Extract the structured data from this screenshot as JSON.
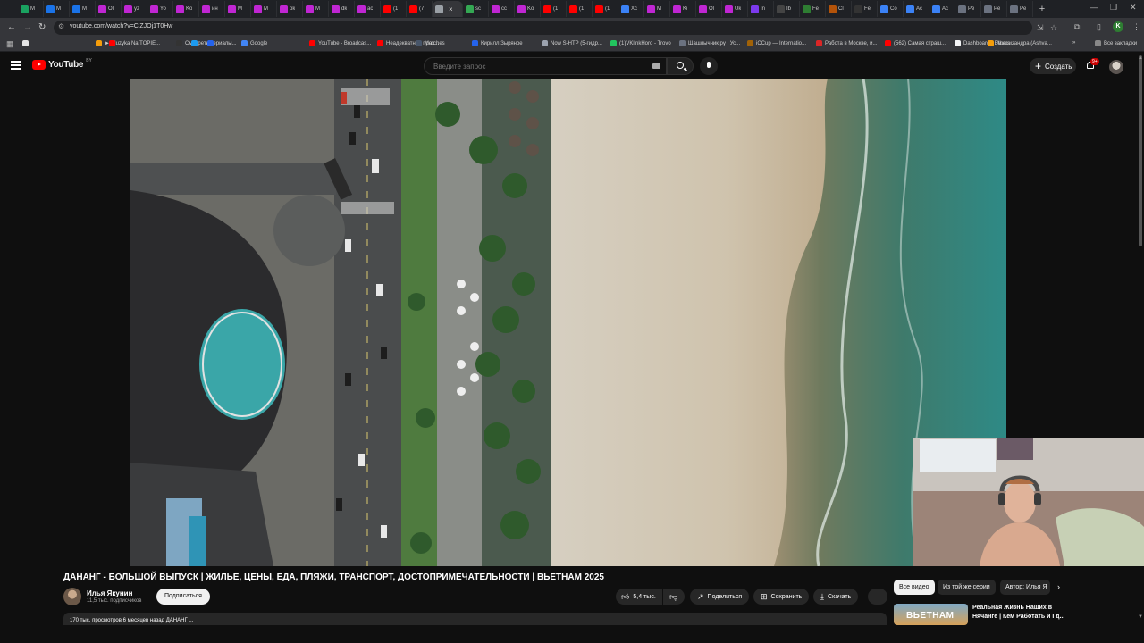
{
  "browser": {
    "tabs": [
      {
        "title": "M",
        "color": "#1aa260"
      },
      {
        "title": "M",
        "color": "#1a73e8"
      },
      {
        "title": "M",
        "color": "#1a73e8"
      },
      {
        "title": "Ol",
        "color": "#c026d3"
      },
      {
        "title": "yz",
        "color": "#c026d3"
      },
      {
        "title": "Yo",
        "color": "#c026d3"
      },
      {
        "title": "Ko",
        "color": "#c026d3"
      },
      {
        "title": "ин",
        "color": "#c026d3"
      },
      {
        "title": "M",
        "color": "#c026d3"
      },
      {
        "title": "M",
        "color": "#c026d3"
      },
      {
        "title": "ok",
        "color": "#c026d3"
      },
      {
        "title": "M",
        "color": "#c026d3"
      },
      {
        "title": "dk",
        "color": "#c026d3"
      },
      {
        "title": "ac",
        "color": "#c026d3"
      },
      {
        "title": "(1",
        "color": "#ff0000"
      },
      {
        "title": "(7",
        "color": "#ff0000"
      },
      {
        "title": "",
        "color": "#9aa0a6",
        "active": true
      },
      {
        "title": "sc",
        "color": "#34a853"
      },
      {
        "title": "cc",
        "color": "#c026d3"
      },
      {
        "title": "Ko",
        "color": "#c026d3"
      },
      {
        "title": "(1",
        "color": "#ff0000"
      },
      {
        "title": "(1",
        "color": "#ff0000"
      },
      {
        "title": "(1",
        "color": "#ff0000"
      },
      {
        "title": "Xc",
        "color": "#3b82f6"
      },
      {
        "title": "M",
        "color": "#c026d3"
      },
      {
        "title": "Ki",
        "color": "#c026d3"
      },
      {
        "title": "Ol",
        "color": "#c026d3"
      },
      {
        "title": "Uk",
        "color": "#c026d3"
      },
      {
        "title": "In",
        "color": "#7c3aed"
      },
      {
        "title": "Ib",
        "color": "#444"
      },
      {
        "title": "Fe",
        "color": "#2e7d32"
      },
      {
        "title": "Cl",
        "color": "#b45309"
      },
      {
        "title": "Fe",
        "color": "#333"
      },
      {
        "title": "Co",
        "color": "#3b82f6"
      },
      {
        "title": "Ac",
        "color": "#3b82f6"
      },
      {
        "title": "Ac",
        "color": "#3b82f6"
      },
      {
        "title": "Pe",
        "color": "#6b7280"
      },
      {
        "title": "Pe",
        "color": "#6b7280"
      },
      {
        "title": "Pe",
        "color": "#6b7280"
      }
    ],
    "new_tab": "+",
    "url": "youtube.com/watch?v=CiZJOj1T0Hw",
    "bookmarks": [
      {
        "label": "",
        "color": "#e5e5e5"
      },
      {
        "label": "► Muzyka Na TOPIE...",
        "color": "#f59e0b"
      },
      {
        "label": "",
        "color": "#ff0000"
      },
      {
        "label": "Смотреть сериалы...",
        "color": "#333"
      },
      {
        "label": "",
        "color": "#1d9bf0"
      },
      {
        "label": "",
        "color": "#2563eb"
      },
      {
        "label": "Google",
        "color": "#4285f4"
      },
      {
        "label": "YouTube - Broadcas...",
        "color": "#ff0000"
      },
      {
        "label": "Неадекватное прох...",
        "color": "#ff0000"
      },
      {
        "label": "Matches",
        "color": "#475569"
      },
      {
        "label": "Кирилл Зыряное",
        "color": "#2563eb"
      },
      {
        "label": "Now S-HTP (5-гидр...",
        "color": "#9ca3af"
      },
      {
        "label": "(1)VKlinkHoro - Trovo",
        "color": "#22c55e"
      },
      {
        "label": "Шашлычник.ру | Ус...",
        "color": "#6b7280"
      },
      {
        "label": "iCCup — Internatio...",
        "color": "#a16207"
      },
      {
        "label": "Работа в Москве, и...",
        "color": "#dc2626"
      },
      {
        "label": "(562) Самая страш...",
        "color": "#ff0000"
      },
      {
        "label": "Dashboard - Ethers...",
        "color": "#f3f4f6"
      },
      {
        "label": "Ашшизандра (Ashva...",
        "color": "#f59e0b"
      }
    ],
    "all_bookmarks": "Все закладки",
    "profile_letter": "K"
  },
  "youtube": {
    "logo_text": "YouTube",
    "logo_country": "BY",
    "search_placeholder": "Введите запрос",
    "create_label": "Создать",
    "notif_count": "9+",
    "video_title": "ДАНАНГ - БОЛЬШОЙ ВЫПУСК | ЖИЛЬЕ, ЦЕНЫ, ЕДА, ПЛЯЖИ, ТРАНСПОРТ, ДОСТОПРИМЕЧАТЕЛЬНОСТИ | ВЬЕТНАМ 2025",
    "channel_name": "Илья Якунин",
    "channel_subs": "11,5 тыс. подписчиков",
    "subscribe_label": "Подписаться",
    "likes": "5,4 тыс.",
    "share_label": "Поделиться",
    "save_label": "Сохранить",
    "download_label": "Скачать",
    "more_label": "⋯",
    "description_preview": "170 тыс. просмотров  6 месяцев назад  ДАНАНГ ...",
    "chips": [
      "Все видео",
      "Из той же серии",
      "Автор: Илья Я"
    ],
    "rec_thumb_text": "ВЬЕТНАМ",
    "rec_title": "Реальная Жизнь Наших в Нячанге | Кем Работать и Гд..."
  },
  "colors": {
    "brand_red": "#ff0000",
    "background": "#0f0f0f",
    "chip": "#272727",
    "subscribe": "#f1f1f1"
  },
  "icons": [
    "hamburger-icon",
    "search-icon",
    "mic-icon",
    "bell-icon",
    "like-icon",
    "dislike-icon",
    "share-icon",
    "save-icon",
    "download-icon",
    "more-icon",
    "chevron-right-icon",
    "keyboard-icon"
  ]
}
